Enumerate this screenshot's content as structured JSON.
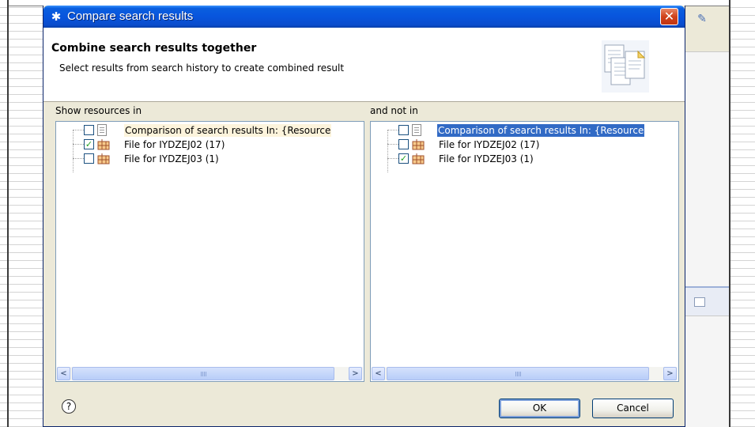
{
  "dialog": {
    "title": "Compare search results",
    "close_glyph": "✕",
    "banner": {
      "heading": "Combine search results together",
      "description": "Select results from search history to create combined result"
    },
    "left_panel": {
      "label": "Show resources in",
      "items": [
        {
          "text": "Comparison of search results In: {Resource",
          "checked": false,
          "icon": "document-icon",
          "style": "highlight"
        },
        {
          "text": "File for IYDZEJ02 (17)",
          "checked": true,
          "icon": "resource-grid-icon",
          "style": "normal"
        },
        {
          "text": "File for IYDZEJ03 (1)",
          "checked": false,
          "icon": "resource-grid-icon",
          "style": "normal"
        }
      ]
    },
    "right_panel": {
      "label": "and not in",
      "items": [
        {
          "text": "Comparison of search results In: {Resource",
          "checked": false,
          "icon": "document-icon",
          "style": "selected"
        },
        {
          "text": "File for IYDZEJ02 (17)",
          "checked": false,
          "icon": "resource-grid-icon",
          "style": "normal"
        },
        {
          "text": "File for IYDZEJ03 (1)",
          "checked": true,
          "icon": "resource-grid-icon",
          "style": "normal"
        }
      ]
    },
    "scroll": {
      "left_arrow": "<",
      "right_arrow": ">"
    },
    "help_glyph": "?",
    "buttons": {
      "ok_label": "OK",
      "cancel_label": "Cancel"
    }
  },
  "colors": {
    "titlebar": "#0855dd",
    "dialog_bg": "#ece9d8",
    "selection": "#316ac5",
    "check_green": "#21a121"
  }
}
